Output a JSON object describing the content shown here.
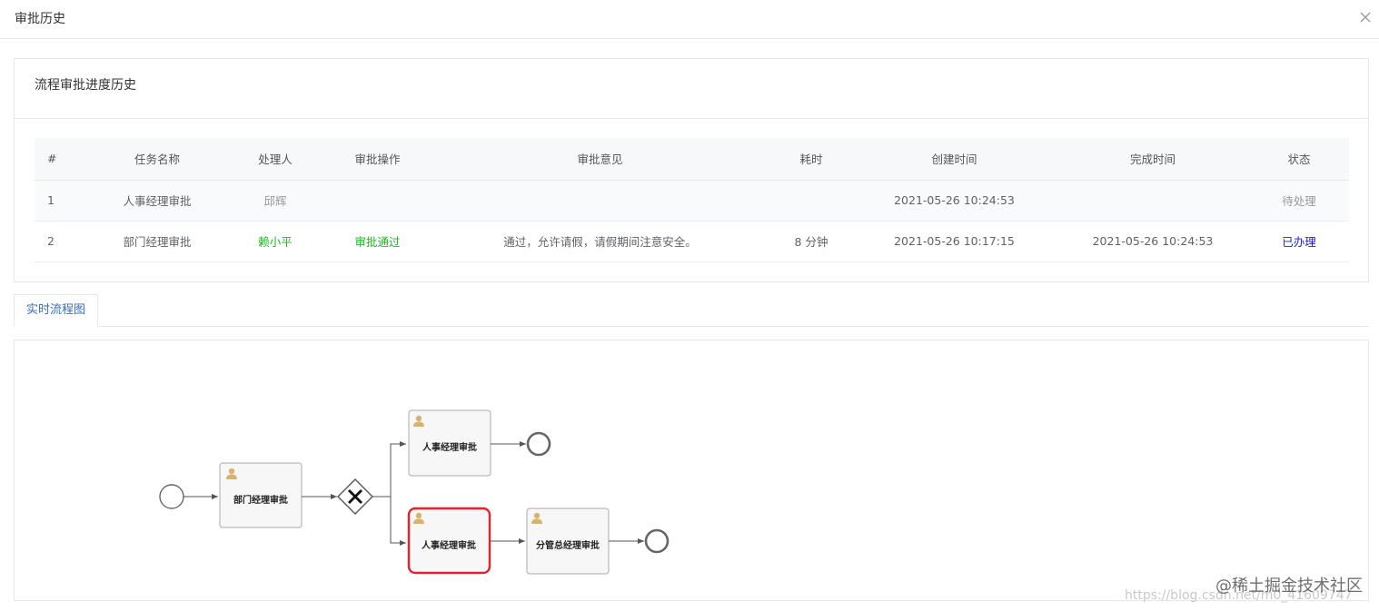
{
  "dialog": {
    "title": "审批历史",
    "close_icon": "close-icon"
  },
  "history": {
    "title": "流程审批进度历史",
    "columns": [
      "#",
      "任务名称",
      "处理人",
      "审批操作",
      "审批意见",
      "耗时",
      "创建时间",
      "完成时间",
      "状态"
    ],
    "rows": [
      {
        "index": "1",
        "task": "人事经理审批",
        "handler": "邱辉",
        "action": "",
        "opinion": "",
        "duration": "",
        "created": "2021-05-26 10:24:53",
        "completed": "",
        "status": "待处理"
      },
      {
        "index": "2",
        "task": "部门经理审批",
        "handler": "赖小平",
        "action": "审批通过",
        "opinion": "通过，允许请假，请假期间注意安全。",
        "duration": "8 分钟",
        "created": "2021-05-26 10:17:15",
        "completed": "2021-05-26 10:24:53",
        "status": "已办理"
      }
    ]
  },
  "tabs": {
    "realtime_label": "实时流程图"
  },
  "flow": {
    "tasks": {
      "dept_manager": "部门经理审批",
      "hr_manager_top": "人事经理审批",
      "hr_manager_active": "人事经理审批",
      "general_manager": "分管总经理审批"
    },
    "colors": {
      "active_border": "#e8202a",
      "task_border": "#aaaaaa",
      "user_icon": "#d9b36a"
    }
  },
  "watermark": {
    "brand": "@稀土掘金技术社区",
    "url": "https://blog.csdn.net/m0_41609747"
  }
}
